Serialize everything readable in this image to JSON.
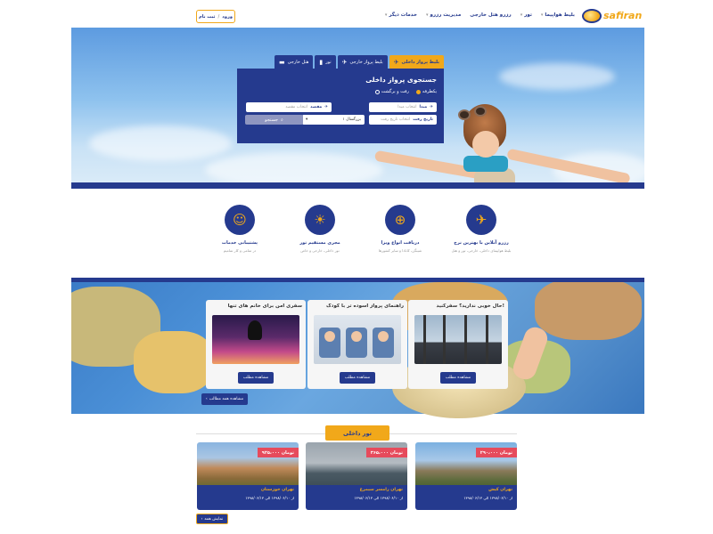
{
  "header": {
    "logo_text": "safiran",
    "nav": [
      {
        "label": "بلیط هواپیما",
        "has_menu": true
      },
      {
        "label": "تور",
        "has_menu": true
      },
      {
        "label": "رزرو هتل خارجی",
        "has_menu": false
      },
      {
        "label": "مدیریت رزرو",
        "has_menu": true
      },
      {
        "label": "خدمات دیگر",
        "has_menu": true
      }
    ],
    "login_label": "ورود",
    "separator": "/",
    "register_label": "ثبت نام"
  },
  "search": {
    "tabs": [
      {
        "label": "بلیط پرواز داخلی",
        "icon": "plane-icon",
        "active": true
      },
      {
        "label": "بلیط پرواز خارجی",
        "icon": "plane-icon",
        "active": false
      },
      {
        "label": "تور",
        "icon": "luggage-icon",
        "active": false
      },
      {
        "label": "هتل خارجی",
        "icon": "bed-icon",
        "active": false
      }
    ],
    "title": "جستجوی پرواز داخلی",
    "trip_options": [
      {
        "label": "یکطرفه",
        "selected": true
      },
      {
        "label": "رفت و برگشت",
        "selected": false
      }
    ],
    "origin": {
      "label": "مبدا",
      "placeholder": "انتخاب مبدا"
    },
    "destination": {
      "label": "مقصد",
      "placeholder": "انتخاب مقصد"
    },
    "depart_date": {
      "label": "تاریخ رفت",
      "placeholder": "انتخاب تاریخ رفت"
    },
    "passengers": "۱ بزرگسال",
    "search_label": "جستجو"
  },
  "features": [
    {
      "icon": "plane-ticket-icon",
      "title": "رزرو آنلاین با بهترین نرخ",
      "subtitle": "بلیط هواپیمای داخلی، خارجی، تور و هتل"
    },
    {
      "icon": "passport-icon",
      "title": "دریافت انواع ویزا",
      "subtitle": "شینگن، کانادا و سایر کشورها"
    },
    {
      "icon": "tour-operator-icon",
      "title": "مجری مستقیم تور",
      "subtitle": "تور داخلی، خارجی و خاص"
    },
    {
      "icon": "support-agent-icon",
      "title": "پشتیبانی خدمات",
      "subtitle": "در تمامی و کار تمامیم"
    }
  ],
  "promos": [
    {
      "title": "حال خوبی ندارید؟ سفرکنید!",
      "button": "مشاهده مطلب"
    },
    {
      "title": "راهنمای پرواز آسوده تر با کودک",
      "button": "مشاهده مطلب"
    },
    {
      "title": "سفری امن برای خانم های تنها",
      "button": "مشاهده مطلب"
    }
  ],
  "promo_see_all": "مشاهده همه مطالب",
  "domestic_tours": {
    "title": "تور داخلی",
    "tours": [
      {
        "name": "تهران کیش",
        "price": "۲۹۰،۰۰۰ تومان",
        "date": "از ۱۳۹۸/۰۶/۱۰ الی ۱۳۹۸/۰۶/۱۳"
      },
      {
        "name": "تهران رامسر سیمرغ",
        "price": "۳۶۵،۰۰۰ تومان",
        "date": "از ۱۳۹۸/۰۶/۱۰ الی ۱۳۹۸/۰۶/۱۳"
      },
      {
        "name": "تهران خوزستان",
        "price": "۹۲۵،۰۰۰ تومان",
        "date": "از ۱۳۹۸/۰۶/۱۰ الی ۱۳۹۸/۰۶/۱۳"
      }
    ],
    "show_all": "نمایش همه"
  },
  "colors": {
    "primary": "#253a8e",
    "accent": "#f1a81a",
    "price": "#e64b5c"
  }
}
